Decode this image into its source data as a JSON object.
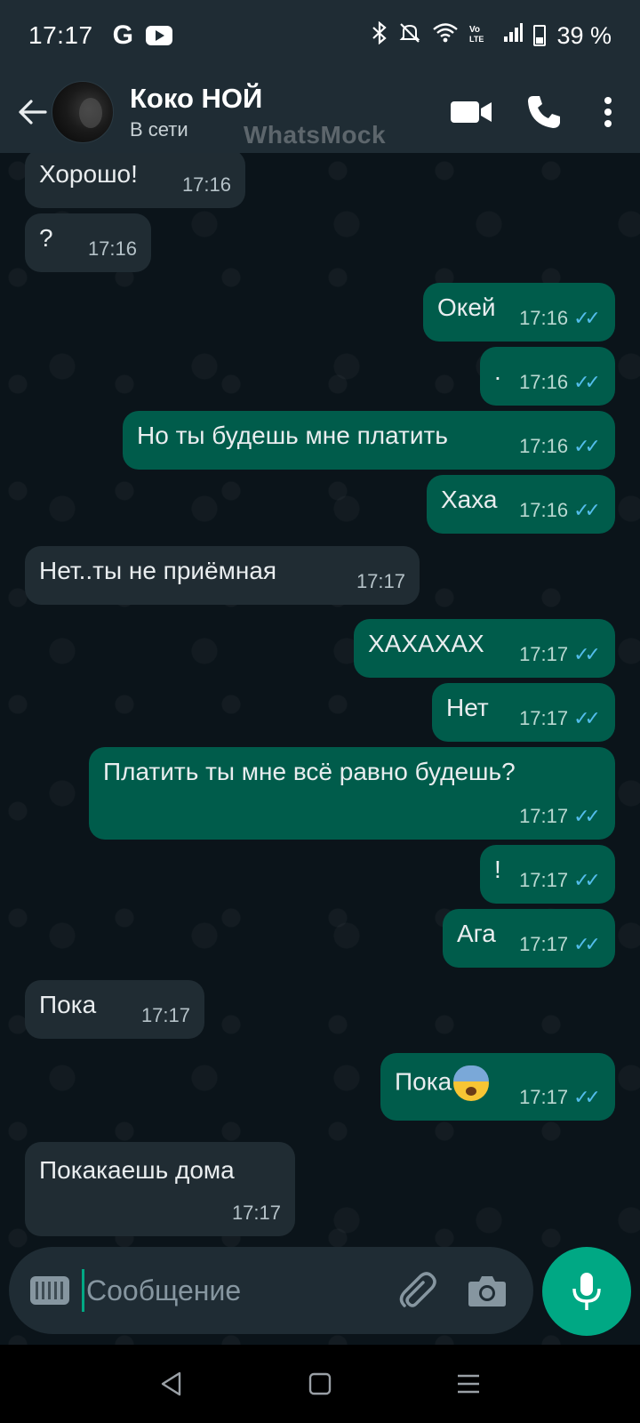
{
  "status_bar": {
    "time": "17:17",
    "left_icons": [
      "google-icon",
      "youtube-icon"
    ],
    "right_icons": [
      "bluetooth-icon",
      "mute-icon",
      "wifi-icon",
      "volte-icon",
      "signal-icon",
      "battery-icon"
    ],
    "battery_label": "39 %"
  },
  "header": {
    "contact_name": "Коко НОЙ",
    "status": "В сети",
    "watermark": "WhatsMock"
  },
  "messages": [
    {
      "dir": "in",
      "text": "Хорошо!",
      "time": "17:16"
    },
    {
      "dir": "in",
      "text": "?",
      "time": "17:16"
    },
    {
      "dir": "out",
      "text": "Окей",
      "time": "17:16",
      "read": true
    },
    {
      "dir": "out",
      "text": ".",
      "time": "17:16",
      "read": true
    },
    {
      "dir": "out",
      "text": "Но ты будешь мне платить",
      "time": "17:16",
      "read": true
    },
    {
      "dir": "out",
      "text": "Хаха",
      "time": "17:16",
      "read": true
    },
    {
      "dir": "in",
      "text": "Нет..ты не приёмная",
      "time": "17:17"
    },
    {
      "dir": "out",
      "text": "ХАХАХАХ",
      "time": "17:17",
      "read": true
    },
    {
      "dir": "out",
      "text": "Нет",
      "time": "17:17",
      "read": true
    },
    {
      "dir": "out",
      "text": "Платить ты мне всё равно будешь?",
      "time": "17:17",
      "read": true
    },
    {
      "dir": "out",
      "text": "!",
      "time": "17:17",
      "read": true
    },
    {
      "dir": "out",
      "text": "Ага",
      "time": "17:17",
      "read": true
    },
    {
      "dir": "in",
      "text": "Пока",
      "time": "17:17"
    },
    {
      "dir": "out",
      "text": "Пока",
      "time": "17:17",
      "read": true,
      "emoji": "anxious-face-emoji"
    },
    {
      "dir": "in",
      "text": "Покакаешь дома",
      "time": "17:17"
    }
  ],
  "read_ticks": "✓✓",
  "input": {
    "placeholder": "Сообщение"
  },
  "colors": {
    "header_bg": "#1f2c34",
    "chat_bg": "#0b141a",
    "incoming_bubble": "#202c33",
    "outgoing_bubble": "#005c4b",
    "accent": "#00a884",
    "read_tick": "#53bdeb"
  }
}
